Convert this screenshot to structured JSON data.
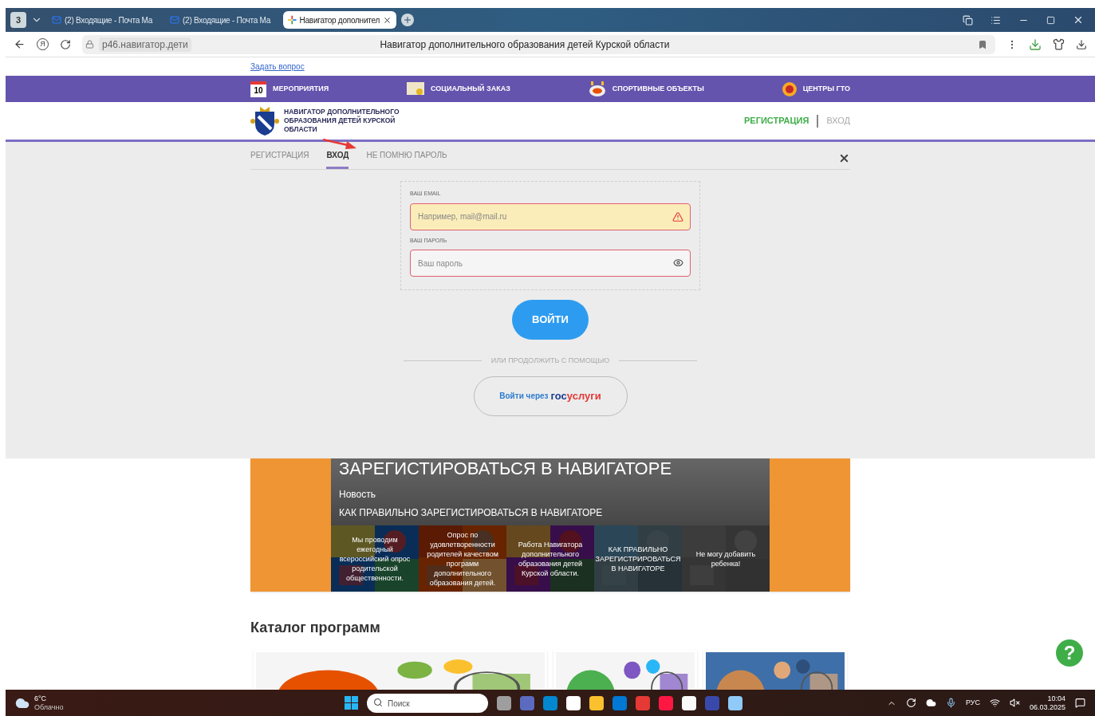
{
  "browser": {
    "tab_count": "3",
    "tabs": [
      {
        "kind": "mail",
        "title": "(2) Входящие - Почта Ма",
        "selected": false
      },
      {
        "kind": "mail",
        "title": "(2) Входящие - Почта Ма",
        "selected": false
      },
      {
        "kind": "site",
        "title": "Навигатор дополнител",
        "selected": true
      }
    ],
    "home_glyph": "Я",
    "url": "p46.навигатор.дети",
    "page_title": "Навигатор дополнительного образования детей Курской области"
  },
  "page": {
    "ask_link": "Задать вопрос",
    "nav": [
      {
        "kind": "calendar",
        "icon_text": "10",
        "label": "МЕРОПРИЯТИЯ"
      },
      {
        "kind": "certificate",
        "label": "СОЦИАЛЬНЫЙ ЗАКАЗ"
      },
      {
        "kind": "stadium",
        "label": "СПОРТИВНЫЕ ОБЪЕКТЫ"
      },
      {
        "kind": "emblem",
        "label": "ЦЕНТРЫ ГТО"
      }
    ],
    "site_title": "НАВИГАТОР ДОПОЛНИТЕЛЬНОГО ОБРАЗОВАНИЯ ДЕТЕЙ КУРСКОЙ ОБЛАСТИ",
    "auth_links": [
      {
        "label": "РЕГИСТРАЦИЯ",
        "selected": true
      },
      {
        "label": "ВХОД",
        "selected": false
      }
    ],
    "modal": {
      "tabs": [
        {
          "label": "РЕГИСТРАЦИЯ",
          "selected": false
        },
        {
          "label": "ВХОД",
          "selected": true
        },
        {
          "label": "НЕ ПОМНЮ ПАРОЛЬ",
          "selected": false
        }
      ],
      "email_label": "ВАШ EMAIL",
      "email_placeholder": "Например, mail@mail.ru",
      "email_invalid": true,
      "password_label": "ВАШ ПАРОЛЬ",
      "password_placeholder": "Ваш пароль",
      "login_button": "ВОЙТИ",
      "divider_text": "ИЛИ ПРОДОЛЖИТЬ С ПОМОЩЬЮ",
      "gosuslugi": {
        "prefix": "Войти через",
        "brand_first": "гос",
        "brand_second": "услуги"
      }
    },
    "news": {
      "heading": "ЗАРЕГИСТИРОВАТЬСЯ В НАВИГАТОРЕ",
      "kind": "Новость",
      "title": "КАК ПРАВИЛЬНО ЗАРЕГИСТИРОВАТЬСЯ В НАВИГАТОРЕ",
      "tiles": [
        {
          "kind": "kids",
          "text": "Мы проводим ежегодный всероссийский опрос родительской общественности."
        },
        {
          "kind": "survey",
          "text": "Опрос по удовлетворенности родителей качеством программ дополнительного образования детей."
        },
        {
          "kind": "puzzle",
          "text": "Работа Навигатора дополнительного образования детей Курской области."
        },
        {
          "kind": "info",
          "text": "КАК ПРАВИЛЬНО ЗАРЕГИСТРИРОВАТЬСЯ В НАВИГАТОРЕ"
        },
        {
          "kind": "doc",
          "text": "Не могу добавить ребенка!"
        }
      ]
    },
    "catalog_title": "Каталог программ",
    "help_glyph": "?"
  },
  "taskbar": {
    "temperature": "6°C",
    "weather": "Облачно",
    "search_placeholder": "Поиск",
    "language": "РУС",
    "time": "10:04",
    "date": "06.03.2025"
  }
}
